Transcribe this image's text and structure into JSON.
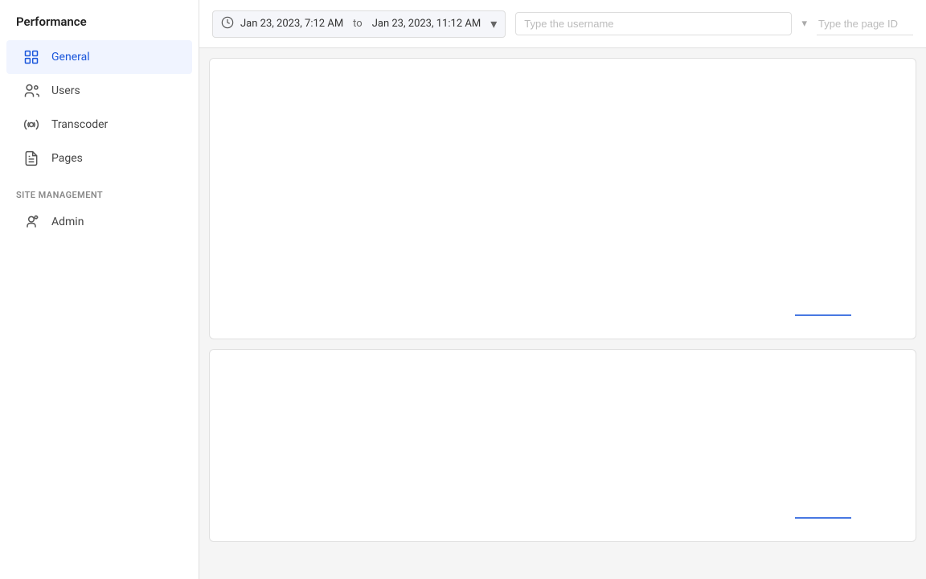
{
  "sidebar": {
    "title": "Performance",
    "nav_items": [
      {
        "id": "general",
        "label": "General",
        "icon": "chart-icon",
        "active": true
      },
      {
        "id": "users",
        "label": "Users",
        "icon": "users-icon",
        "active": false
      },
      {
        "id": "transcoder",
        "label": "Transcoder",
        "icon": "transcoder-icon",
        "active": false
      },
      {
        "id": "pages",
        "label": "Pages",
        "icon": "pages-icon",
        "active": false
      }
    ],
    "section_management": "Site management",
    "management_items": [
      {
        "id": "admin",
        "label": "Admin",
        "icon": "admin-icon",
        "active": false
      }
    ]
  },
  "toolbar": {
    "date_from": "Jan 23, 2023, 7:12 AM",
    "date_to": "Jan 23, 2023, 11:12 AM",
    "date_separator": "to",
    "username_placeholder": "Type the username",
    "page_placeholder": "Type the page ID"
  },
  "charts": [
    {
      "id": "chart-top"
    },
    {
      "id": "chart-bottom"
    }
  ]
}
